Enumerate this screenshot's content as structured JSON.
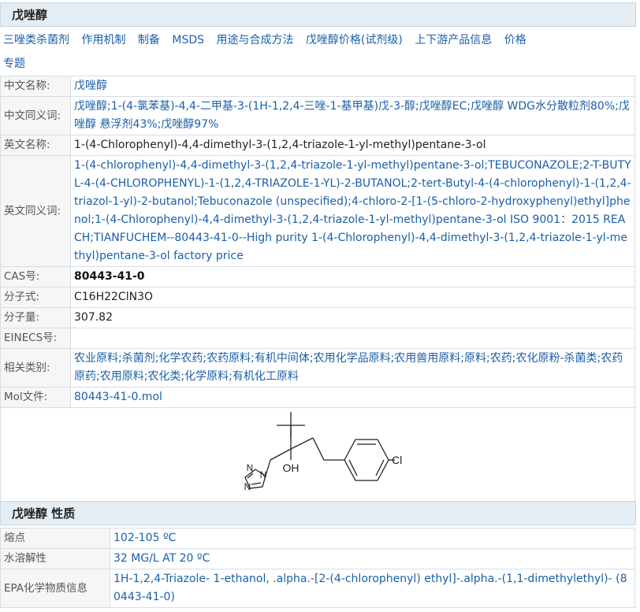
{
  "header": {
    "title": "戊唑醇"
  },
  "nav": {
    "items": [
      "三唑类杀菌剂",
      "作用机制",
      "制备",
      "MSDS",
      "用途与合成方法",
      "戊唑醇价格(试剂级)",
      "上下游产品信息",
      "价格",
      "专题"
    ]
  },
  "info": {
    "rows": [
      {
        "label": "中文名称:",
        "value": "戊唑醇"
      },
      {
        "label": "中文同义词:",
        "value": "戊唑醇;1-(4-氯苯基)-4,4-二甲基-3-(1H-1,2,4-三唑-1-基甲基)戊-3-醇;戊唑醇EC;戊唑醇 WDG水分散粒剂80%;戊唑醇 悬浮剂43%;戊唑醇97%"
      },
      {
        "label": "英文名称:",
        "value": "1-(4-Chlorophenyl)-4,4-dimethyl-3-(1,2,4-triazole-1-yl-methyl)pentane-3-ol"
      },
      {
        "label": "英文同义词:",
        "value": "1-(4-chlorophenyl)-4,4-dimethyl-3-(1,2,4-triazole-1-yl-methyl)pentane-3-ol;TEBUCONAZOLE;2-T-BUTYL-4-(4-CHLOROPHENYL)-1-(1,2,4-TRIAZOLE-1-YL)-2-BUTANOL;2-tert-Butyl-4-(4-chlorophenyl)-1-(1,2,4-triazol-1-yl)-2-butanol;Tebuconazole (unspecified);4-chloro-2-[1-(5-chloro-2-hydroxyphenyl)ethyl]phenol;1-(4-Chlorophenyl)-4,4-dimethyl-3-(1,2,4-triazole-1-yl-methyl)pentane-3-ol ISO 9001：2015 REACH;TIANFUCHEM--80443-41-0--High purity 1-(4-Chlorophenyl)-4,4-dimethyl-3-(1,2,4-triazole-1-yl-methyl)pentane-3-ol factory price"
      },
      {
        "label": "CAS号:",
        "value": "80443-41-0"
      },
      {
        "label": "分子式:",
        "value": "C16H22ClN3O"
      },
      {
        "label": "分子量:",
        "value": "307.82"
      },
      {
        "label": "EINECS号:",
        "value": ""
      },
      {
        "label": "相关类别:",
        "value": "农业原料;杀菌剂;化学农药;农药原料;有机中间体;农用化学品原料;农用兽用原料;原料;农药;农化原粉-杀菌类;农药原药;农用原料;农化类;化学原料;有机化工原料"
      },
      {
        "label": "Mol文件:",
        "value": "80443-41-0.mol"
      }
    ],
    "structure": {
      "oh_label": "OH",
      "cl_label": "Cl",
      "n_label": "N"
    }
  },
  "properties": {
    "title": "戊唑醇 性质",
    "rows": [
      {
        "label": "熔点",
        "value": "102-105 ºC"
      },
      {
        "label": "水溶解性",
        "value": "32 MG/L AT 20 ºC"
      },
      {
        "label": "EPA化学物质信息",
        "value": "1H-1,2,4-Triazole- 1-ethanol, .alpha.-[2-(4-chlorophenyl) ethyl]-.alpha.-(1,1-dimethylethyl)- (80443-41-0)"
      }
    ]
  }
}
